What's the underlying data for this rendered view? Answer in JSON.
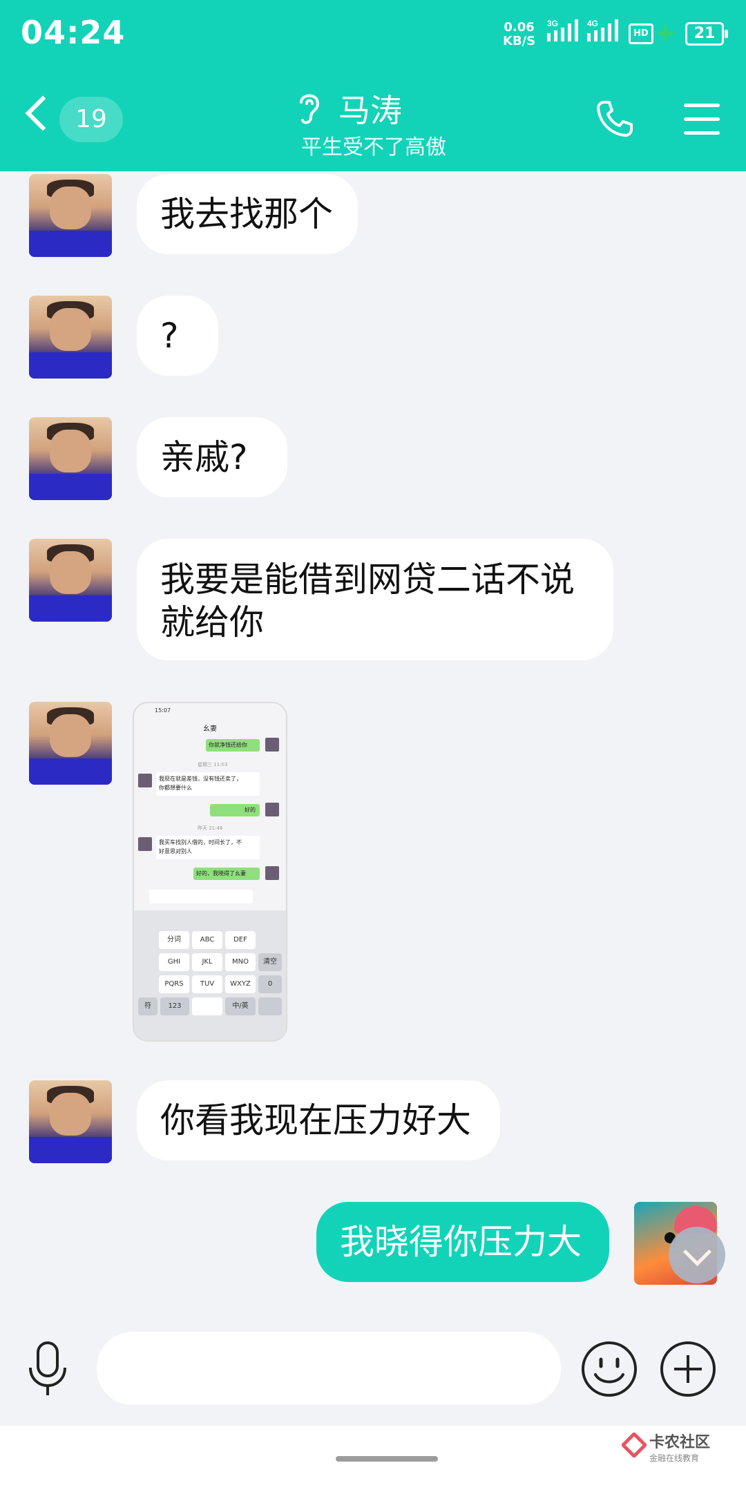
{
  "status_bar": {
    "time": "04:24",
    "net_speed_value": "0.06",
    "net_speed_unit": "KB/S",
    "sim1": "3G",
    "sim2": "4G",
    "hd": "HD",
    "battery": "21"
  },
  "header": {
    "unread_count": "19",
    "contact_name": "马涛",
    "signature": "平生受不了高傲"
  },
  "messages": [
    {
      "side": "left",
      "type": "text",
      "text": "我去找那个"
    },
    {
      "side": "left",
      "type": "text",
      "text": "?"
    },
    {
      "side": "left",
      "type": "text",
      "text": "亲戚?"
    },
    {
      "side": "left",
      "type": "text",
      "text_line1": "我要是能借到网贷二话不说",
      "text_line2": "就给你"
    },
    {
      "side": "left",
      "type": "image"
    },
    {
      "side": "left",
      "type": "text",
      "text": "你看我现在压力好大"
    },
    {
      "side": "right",
      "type": "text",
      "text": "我晓得你压力大"
    }
  ],
  "screenshot_image": {
    "time": "15:07",
    "title": "幺妻",
    "msg1": "你就净钱还给你",
    "ts1": "星期三 11:03",
    "msg2_line1": "我现在就是差钱，没有钱还卖了，",
    "msg2_line2": "你都想要什么",
    "msg3": "好的",
    "ts2": "昨天 21:46",
    "msg4_line1": "我买车找别人借的，时间长了，不",
    "msg4_line2": "好意思对别人",
    "msg5": "好的，我晓得了幺妻",
    "keys_row1": [
      "分词",
      "ABC",
      "DEF"
    ],
    "keys_row2": [
      "GHI",
      "JKL",
      "MNO"
    ],
    "keys_row3": [
      "PQRS",
      "TUV",
      "WXYZ"
    ],
    "side_keys": [
      "清空",
      "0"
    ],
    "bottom_keys": [
      "符",
      "123",
      "中/英"
    ]
  },
  "input": {
    "placeholder": ""
  },
  "watermark": {
    "title": "卡农社区",
    "subtitle": "金融在线教育"
  },
  "colors": {
    "accent": "#12d3b8",
    "background": "#f2f3f7"
  }
}
